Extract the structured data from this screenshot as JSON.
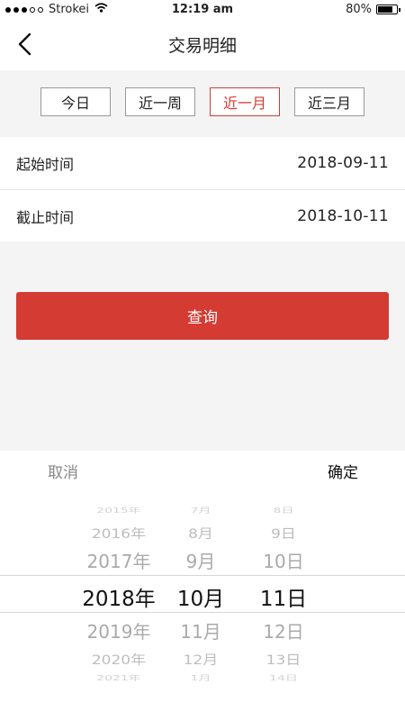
{
  "status_bar": {
    "carrier": "Strokei",
    "time": "12:19 am",
    "battery": "80%",
    "battery_level": 0.8
  },
  "nav": {
    "title": "交易明细"
  },
  "filters": [
    {
      "label": "今日",
      "active": false
    },
    {
      "label": "近一周",
      "active": false
    },
    {
      "label": "近一月",
      "active": true
    },
    {
      "label": "近三月",
      "active": false
    }
  ],
  "form": {
    "start_label": "起始时间",
    "start_value": "2018-09-11",
    "end_label": "截止时间",
    "end_value": "2018-10-11"
  },
  "query_button": "查询",
  "picker": {
    "cancel": "取消",
    "confirm": "确定",
    "years": [
      "2015年",
      "2016年",
      "2017年",
      "2018年",
      "2019年",
      "2020年",
      "2021年"
    ],
    "months": [
      "7月",
      "8月",
      "9月",
      "10月",
      "11月",
      "12月",
      "1月"
    ],
    "days": [
      "8日",
      "9日",
      "10日",
      "11日",
      "12日",
      "13日",
      "14日"
    ]
  },
  "colors": {
    "accent": "#d43b33",
    "background": "#f4f4f4"
  }
}
